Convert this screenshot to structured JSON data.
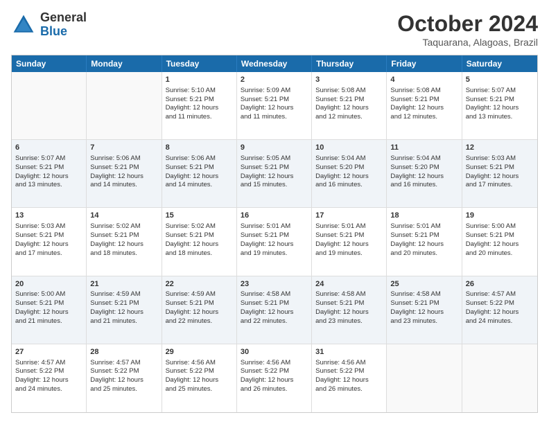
{
  "logo": {
    "general": "General",
    "blue": "Blue"
  },
  "title": "October 2024",
  "location": "Taquarana, Alagoas, Brazil",
  "weekdays": [
    "Sunday",
    "Monday",
    "Tuesday",
    "Wednesday",
    "Thursday",
    "Friday",
    "Saturday"
  ],
  "weeks": [
    [
      {
        "day": "",
        "empty": true,
        "lines": []
      },
      {
        "day": "",
        "empty": true,
        "lines": []
      },
      {
        "day": "1",
        "empty": false,
        "lines": [
          "Sunrise: 5:10 AM",
          "Sunset: 5:21 PM",
          "Daylight: 12 hours",
          "and 11 minutes."
        ]
      },
      {
        "day": "2",
        "empty": false,
        "lines": [
          "Sunrise: 5:09 AM",
          "Sunset: 5:21 PM",
          "Daylight: 12 hours",
          "and 11 minutes."
        ]
      },
      {
        "day": "3",
        "empty": false,
        "lines": [
          "Sunrise: 5:08 AM",
          "Sunset: 5:21 PM",
          "Daylight: 12 hours",
          "and 12 minutes."
        ]
      },
      {
        "day": "4",
        "empty": false,
        "lines": [
          "Sunrise: 5:08 AM",
          "Sunset: 5:21 PM",
          "Daylight: 12 hours",
          "and 12 minutes."
        ]
      },
      {
        "day": "5",
        "empty": false,
        "lines": [
          "Sunrise: 5:07 AM",
          "Sunset: 5:21 PM",
          "Daylight: 12 hours",
          "and 13 minutes."
        ]
      }
    ],
    [
      {
        "day": "6",
        "empty": false,
        "lines": [
          "Sunrise: 5:07 AM",
          "Sunset: 5:21 PM",
          "Daylight: 12 hours",
          "and 13 minutes."
        ]
      },
      {
        "day": "7",
        "empty": false,
        "lines": [
          "Sunrise: 5:06 AM",
          "Sunset: 5:21 PM",
          "Daylight: 12 hours",
          "and 14 minutes."
        ]
      },
      {
        "day": "8",
        "empty": false,
        "lines": [
          "Sunrise: 5:06 AM",
          "Sunset: 5:21 PM",
          "Daylight: 12 hours",
          "and 14 minutes."
        ]
      },
      {
        "day": "9",
        "empty": false,
        "lines": [
          "Sunrise: 5:05 AM",
          "Sunset: 5:21 PM",
          "Daylight: 12 hours",
          "and 15 minutes."
        ]
      },
      {
        "day": "10",
        "empty": false,
        "lines": [
          "Sunrise: 5:04 AM",
          "Sunset: 5:20 PM",
          "Daylight: 12 hours",
          "and 16 minutes."
        ]
      },
      {
        "day": "11",
        "empty": false,
        "lines": [
          "Sunrise: 5:04 AM",
          "Sunset: 5:20 PM",
          "Daylight: 12 hours",
          "and 16 minutes."
        ]
      },
      {
        "day": "12",
        "empty": false,
        "lines": [
          "Sunrise: 5:03 AM",
          "Sunset: 5:21 PM",
          "Daylight: 12 hours",
          "and 17 minutes."
        ]
      }
    ],
    [
      {
        "day": "13",
        "empty": false,
        "lines": [
          "Sunrise: 5:03 AM",
          "Sunset: 5:21 PM",
          "Daylight: 12 hours",
          "and 17 minutes."
        ]
      },
      {
        "day": "14",
        "empty": false,
        "lines": [
          "Sunrise: 5:02 AM",
          "Sunset: 5:21 PM",
          "Daylight: 12 hours",
          "and 18 minutes."
        ]
      },
      {
        "day": "15",
        "empty": false,
        "lines": [
          "Sunrise: 5:02 AM",
          "Sunset: 5:21 PM",
          "Daylight: 12 hours",
          "and 18 minutes."
        ]
      },
      {
        "day": "16",
        "empty": false,
        "lines": [
          "Sunrise: 5:01 AM",
          "Sunset: 5:21 PM",
          "Daylight: 12 hours",
          "and 19 minutes."
        ]
      },
      {
        "day": "17",
        "empty": false,
        "lines": [
          "Sunrise: 5:01 AM",
          "Sunset: 5:21 PM",
          "Daylight: 12 hours",
          "and 19 minutes."
        ]
      },
      {
        "day": "18",
        "empty": false,
        "lines": [
          "Sunrise: 5:01 AM",
          "Sunset: 5:21 PM",
          "Daylight: 12 hours",
          "and 20 minutes."
        ]
      },
      {
        "day": "19",
        "empty": false,
        "lines": [
          "Sunrise: 5:00 AM",
          "Sunset: 5:21 PM",
          "Daylight: 12 hours",
          "and 20 minutes."
        ]
      }
    ],
    [
      {
        "day": "20",
        "empty": false,
        "lines": [
          "Sunrise: 5:00 AM",
          "Sunset: 5:21 PM",
          "Daylight: 12 hours",
          "and 21 minutes."
        ]
      },
      {
        "day": "21",
        "empty": false,
        "lines": [
          "Sunrise: 4:59 AM",
          "Sunset: 5:21 PM",
          "Daylight: 12 hours",
          "and 21 minutes."
        ]
      },
      {
        "day": "22",
        "empty": false,
        "lines": [
          "Sunrise: 4:59 AM",
          "Sunset: 5:21 PM",
          "Daylight: 12 hours",
          "and 22 minutes."
        ]
      },
      {
        "day": "23",
        "empty": false,
        "lines": [
          "Sunrise: 4:58 AM",
          "Sunset: 5:21 PM",
          "Daylight: 12 hours",
          "and 22 minutes."
        ]
      },
      {
        "day": "24",
        "empty": false,
        "lines": [
          "Sunrise: 4:58 AM",
          "Sunset: 5:21 PM",
          "Daylight: 12 hours",
          "and 23 minutes."
        ]
      },
      {
        "day": "25",
        "empty": false,
        "lines": [
          "Sunrise: 4:58 AM",
          "Sunset: 5:21 PM",
          "Daylight: 12 hours",
          "and 23 minutes."
        ]
      },
      {
        "day": "26",
        "empty": false,
        "lines": [
          "Sunrise: 4:57 AM",
          "Sunset: 5:22 PM",
          "Daylight: 12 hours",
          "and 24 minutes."
        ]
      }
    ],
    [
      {
        "day": "27",
        "empty": false,
        "lines": [
          "Sunrise: 4:57 AM",
          "Sunset: 5:22 PM",
          "Daylight: 12 hours",
          "and 24 minutes."
        ]
      },
      {
        "day": "28",
        "empty": false,
        "lines": [
          "Sunrise: 4:57 AM",
          "Sunset: 5:22 PM",
          "Daylight: 12 hours",
          "and 25 minutes."
        ]
      },
      {
        "day": "29",
        "empty": false,
        "lines": [
          "Sunrise: 4:56 AM",
          "Sunset: 5:22 PM",
          "Daylight: 12 hours",
          "and 25 minutes."
        ]
      },
      {
        "day": "30",
        "empty": false,
        "lines": [
          "Sunrise: 4:56 AM",
          "Sunset: 5:22 PM",
          "Daylight: 12 hours",
          "and 26 minutes."
        ]
      },
      {
        "day": "31",
        "empty": false,
        "lines": [
          "Sunrise: 4:56 AM",
          "Sunset: 5:22 PM",
          "Daylight: 12 hours",
          "and 26 minutes."
        ]
      },
      {
        "day": "",
        "empty": true,
        "lines": []
      },
      {
        "day": "",
        "empty": true,
        "lines": []
      }
    ]
  ]
}
